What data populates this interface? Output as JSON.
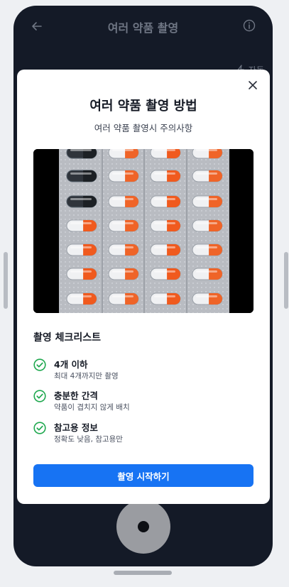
{
  "header": {
    "title": "여러 약품 촬영"
  },
  "camera": {
    "auto_label": "자동"
  },
  "modal": {
    "title": "여러 약품 촬영 방법",
    "subtitle": "여러 약품 촬영시 주의사항",
    "checklist_title": "촬영 체크리스트",
    "items": [
      {
        "title": "4개 이하",
        "desc": "최대 4개까지만 촬영"
      },
      {
        "title": "충분한 간격",
        "desc": "약품이 겹치지 않게 배치"
      },
      {
        "title": "참고용 정보",
        "desc": "정확도 낮음, 참고용만"
      }
    ],
    "start_button": "촬영 시작하기"
  },
  "colors": {
    "accent": "#1773f3",
    "check": "#1fa84f",
    "phone_bg": "#141a27"
  },
  "icons": {
    "back": "arrow-left-icon",
    "info": "info-icon",
    "close": "close-icon",
    "check": "check-circle-icon",
    "auto": "flash-auto-icon"
  }
}
